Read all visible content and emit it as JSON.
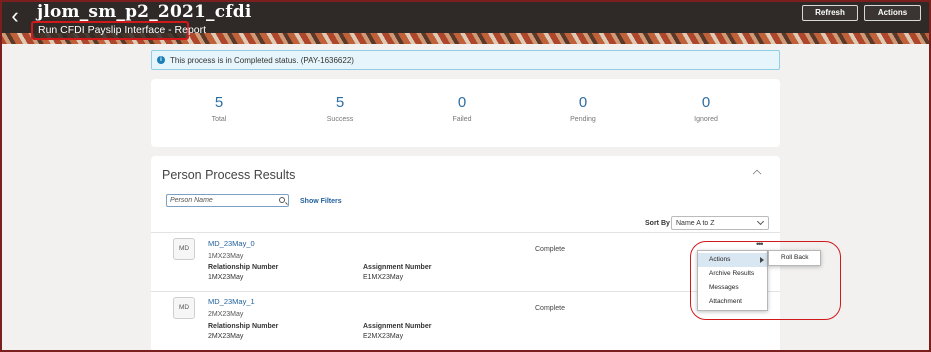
{
  "header": {
    "title": "jlom_sm_p2_2021_cfdi",
    "subtitle": "Run CFDI Payslip Interface - Report",
    "refresh_label": "Refresh",
    "actions_label": "Actions",
    "back_icon": "chevron-left-icon"
  },
  "info": {
    "message": "This process is in Completed status. (PAY-1636622)",
    "icon": "info-icon"
  },
  "summary": [
    {
      "value": "5",
      "label": "Total"
    },
    {
      "value": "5",
      "label": "Success"
    },
    {
      "value": "0",
      "label": "Failed"
    },
    {
      "value": "0",
      "label": "Pending"
    },
    {
      "value": "0",
      "label": "Ignored"
    }
  ],
  "results": {
    "title": "Person Process Results",
    "search_placeholder": "Person Name",
    "show_filters": "Show Filters",
    "sort_by_label": "Sort By",
    "sort_value": "Name A to Z",
    "rows": [
      {
        "initials": "MD",
        "name": "MD_23May_0",
        "id": "1MX23May",
        "relationship_label": "Relationship Number",
        "relationship_value": "1MX23May",
        "assignment_label": "Assignment Number",
        "assignment_value": "E1MX23May",
        "status": "Complete"
      },
      {
        "initials": "MD",
        "name": "MD_23May_1",
        "id": "2MX23May",
        "relationship_label": "Relationship Number",
        "relationship_value": "2MX23May",
        "assignment_label": "Assignment Number",
        "assignment_value": "E2MX23May",
        "status": "Complete"
      }
    ]
  },
  "menu": {
    "items": [
      "Actions",
      "Archive Results",
      "Messages",
      "Attachment"
    ],
    "submenu": [
      "Roll Back"
    ]
  },
  "colors": {
    "header_bg": "#2f2a27",
    "link": "#1f5f9a",
    "stat_number": "#2d6ea4",
    "annotation_red": "#d0191b",
    "info_bg": "#e6f5fb"
  }
}
